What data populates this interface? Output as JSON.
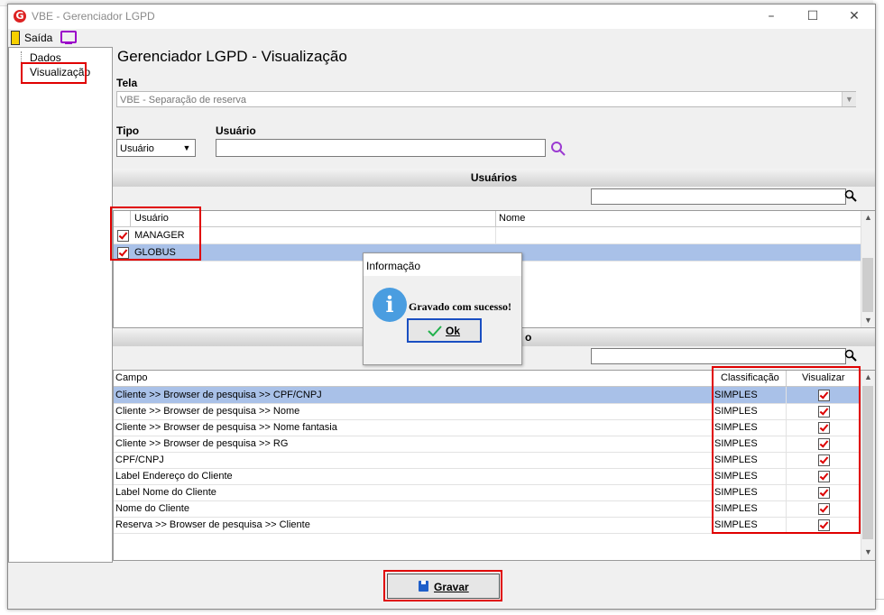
{
  "window": {
    "title": "VBE - Gerenciador LGPD",
    "logo_letter": "G"
  },
  "toolbar": {
    "exit_label": "Saída"
  },
  "nav": {
    "items": [
      "Dados",
      "Visualização"
    ]
  },
  "page_title": "Gerenciador LGPD - Visualização",
  "tela": {
    "label": "Tela",
    "value": "VBE - Separação de reserva"
  },
  "tipo": {
    "label": "Tipo",
    "value": "Usuário"
  },
  "usuario_field": {
    "label": "Usuário",
    "value": ""
  },
  "users_section": {
    "title": "Usuários",
    "columns": [
      "Usuário",
      "Nome"
    ],
    "rows": [
      {
        "usuario": "MANAGER",
        "nome": "",
        "checked": true
      },
      {
        "usuario": "GLOBUS",
        "nome": "",
        "checked": true
      }
    ]
  },
  "fields_section": {
    "title_partial": "o",
    "columns": [
      "Campo",
      "Classificação",
      "Visualizar"
    ],
    "rows": [
      {
        "campo": "Cliente >> Browser de pesquisa >> CPF/CNPJ",
        "classificacao": "SIMPLES",
        "visualizar": true
      },
      {
        "campo": "Cliente >> Browser de pesquisa >> Nome",
        "classificacao": "SIMPLES",
        "visualizar": true
      },
      {
        "campo": "Cliente >> Browser de pesquisa >> Nome fantasia",
        "classificacao": "SIMPLES",
        "visualizar": true
      },
      {
        "campo": "Cliente >> Browser de pesquisa >> RG",
        "classificacao": "SIMPLES",
        "visualizar": true
      },
      {
        "campo": "CPF/CNPJ",
        "classificacao": "SIMPLES",
        "visualizar": true
      },
      {
        "campo": "Label Endereço do Cliente",
        "classificacao": "SIMPLES",
        "visualizar": true
      },
      {
        "campo": "Label Nome do Cliente",
        "classificacao": "SIMPLES",
        "visualizar": true
      },
      {
        "campo": "Nome do Cliente",
        "classificacao": "SIMPLES",
        "visualizar": true
      },
      {
        "campo": "Reserva >> Browser de pesquisa >> Cliente",
        "classificacao": "SIMPLES",
        "visualizar": true
      }
    ]
  },
  "dialog": {
    "title": "Informação",
    "message": "Gravado com sucesso!",
    "ok_label": "Ok"
  },
  "gravar_label": "Gravar",
  "colors": {
    "selection": "#a9c1e8",
    "highlight": "#e00000",
    "info": "#4a9de0"
  }
}
